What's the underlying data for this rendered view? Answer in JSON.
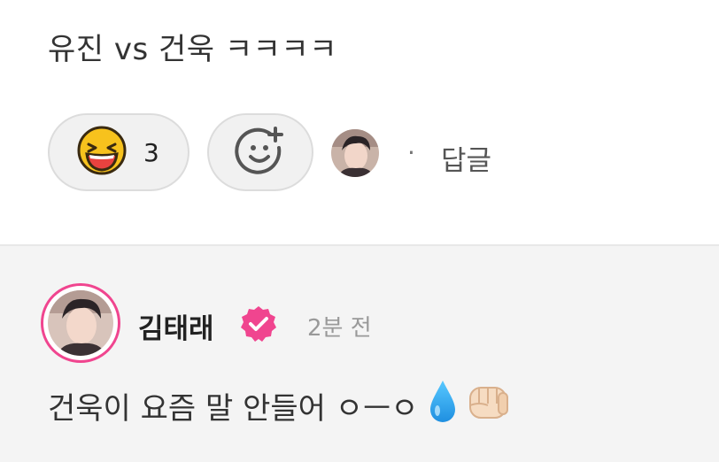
{
  "post": {
    "text": "유진 vs 건욱 ㅋㅋㅋㅋ"
  },
  "reactions": {
    "emoji_icon": "laughing-face-icon",
    "count": "3",
    "add_icon": "add-reaction-icon",
    "separator": "·",
    "reply_label": "답글"
  },
  "comment": {
    "author": "김태래",
    "verified_icon": "verified-badge-icon",
    "time": "2분 전",
    "text": "건욱이 요즘 말 안들어 ㅇㅡㅇ",
    "emojis": [
      "droplet-icon",
      "fist-icon"
    ]
  },
  "colors": {
    "accent_pink": "#f0458f",
    "pill_bg": "#f1f1f1",
    "comment_bg": "#f4f4f4"
  }
}
